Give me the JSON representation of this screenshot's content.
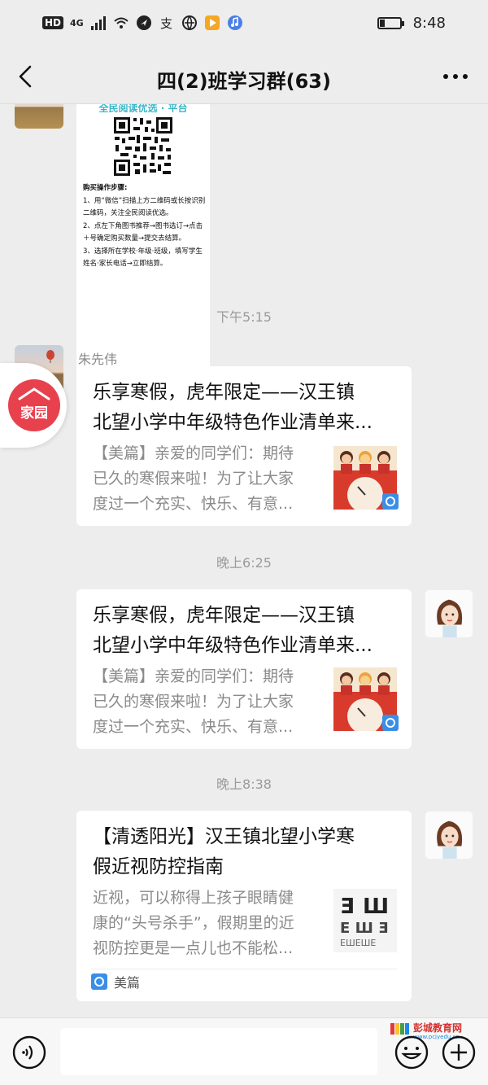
{
  "status_bar": {
    "hd": "HD",
    "signal": "4G",
    "time": "8:48"
  },
  "header": {
    "title": "四(2)班学习群(63)"
  },
  "messages": {
    "image_card": {
      "banner": "全民阅读优选 · 平台",
      "steps_title": "购买操作步骤:",
      "steps": [
        "1、用“微信”扫描上方二维码或长按识别二维码，关注全民阅读优选。",
        "2、点左下角图书推荐→图书选订→点击＋号确定购买数量→提交去结算。",
        "3、选择所在学校·年级·班级，填写学生姓名·家长电话→立即结算。"
      ]
    },
    "time1": "下午5:15",
    "sender1": "朱先伟",
    "card1": {
      "title_line1": "乐享寒假，虎年限定——汉王镇",
      "title_line2": "北望小学中年级特色作业清单来...",
      "desc_line1": "【美篇】亲爱的同学们：期待",
      "desc_line2": "已久的寒假来啦！为了让大家",
      "desc_line3": "度过一个充实、快乐、有意..."
    },
    "time2": "晚上6:25",
    "card2": {
      "title_line1": "乐享寒假，虎年限定——汉王镇",
      "title_line2": "北望小学中年级特色作业清单来...",
      "desc_line1": "【美篇】亲爱的同学们：期待",
      "desc_line2": "已久的寒假来啦！为了让大家",
      "desc_line3": "度过一个充实、快乐、有意..."
    },
    "time3": "晚上8:38",
    "card3": {
      "title_line1": "【清透阳光】汉王镇北望小学寒",
      "title_line2": "假近视防控指南",
      "desc_line1": "近视，可以称得上孩子眼睛健",
      "desc_line2": "康的“头号杀手”，假期里的近",
      "desc_line3": "视防控更是一点儿也不能松...",
      "source": "美篇"
    }
  },
  "floating_badge": {
    "label": "家园"
  },
  "watermark": {
    "name": "彭城教育网",
    "url": "www.pcjyedu.cn"
  },
  "colors": {
    "background": "#ededed",
    "card": "#ffffff",
    "meipian_blue": "#3a8ee6",
    "badge_red": "#e8414e"
  }
}
